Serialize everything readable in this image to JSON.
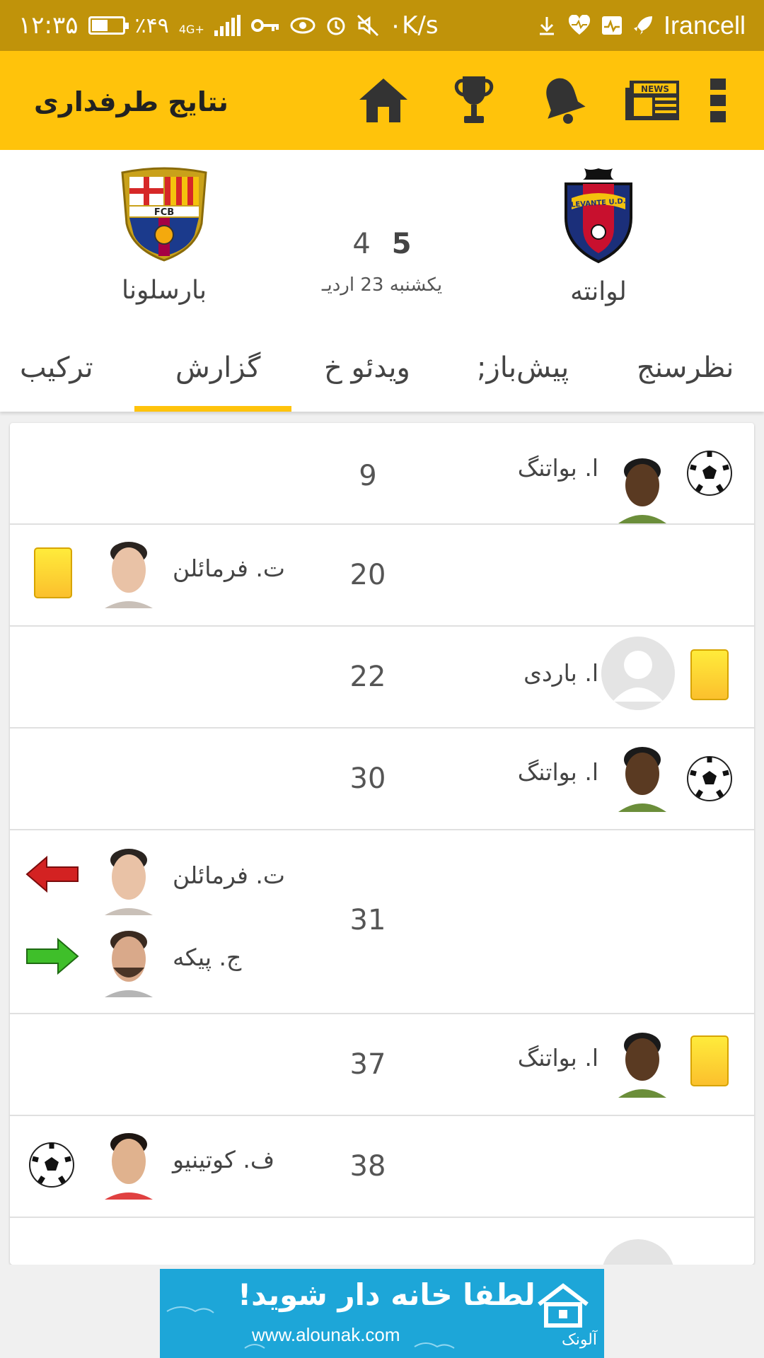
{
  "status_bar": {
    "time": "۱۲:۳۵",
    "battery": "٪۴۹",
    "battery_level": 0.49,
    "network": "4G+",
    "speed": "۰K/s",
    "carrier": "Irancell"
  },
  "app_bar": {
    "title": "نتایج طرفداری",
    "icons": [
      "home-icon",
      "trophy-icon",
      "bell-icon",
      "news-icon",
      "overflow-menu-icon"
    ],
    "news_label": "NEWS",
    "color": "#ffc30b"
  },
  "match": {
    "home_team": "لوانته",
    "away_team": "بارسلونا",
    "home_score": "5",
    "away_score": "4",
    "date": "یکشنبه 23 اردیـ",
    "home_logo_text": "LEVANTE U.D.",
    "away_logo_text": "FCB"
  },
  "tabs": [
    {
      "label": "نظرسنج"
    },
    {
      "label": "پیش‌باز;"
    },
    {
      "label": "ویدئو خ"
    },
    {
      "label": "گزارش"
    },
    {
      "label": "ترکیب"
    }
  ],
  "active_tab": "گزارش",
  "events": [
    {
      "minute": "9",
      "side": "home",
      "type": "goal",
      "player": "ا. بواتنگ"
    },
    {
      "minute": "20",
      "side": "away",
      "type": "yellow-card",
      "player": "ت. فرمائلن"
    },
    {
      "minute": "22",
      "side": "home",
      "type": "yellow-card",
      "player": "ا. باردی"
    },
    {
      "minute": "30",
      "side": "home",
      "type": "goal",
      "player": "ا. بواتنگ"
    },
    {
      "minute": "31",
      "side": "away",
      "type": "substitution",
      "player_out": "ت. فرمائلن",
      "player_in": "ج. پیکه"
    },
    {
      "minute": "37",
      "side": "home",
      "type": "yellow-card",
      "player": "ا. بواتنگ"
    },
    {
      "minute": "38",
      "side": "away",
      "type": "goal",
      "player": "ف. کوتینیو"
    }
  ],
  "ad": {
    "headline": "لطفا خانه دار شوید!",
    "url": "www.alounak.com",
    "brand": "آلونک"
  }
}
